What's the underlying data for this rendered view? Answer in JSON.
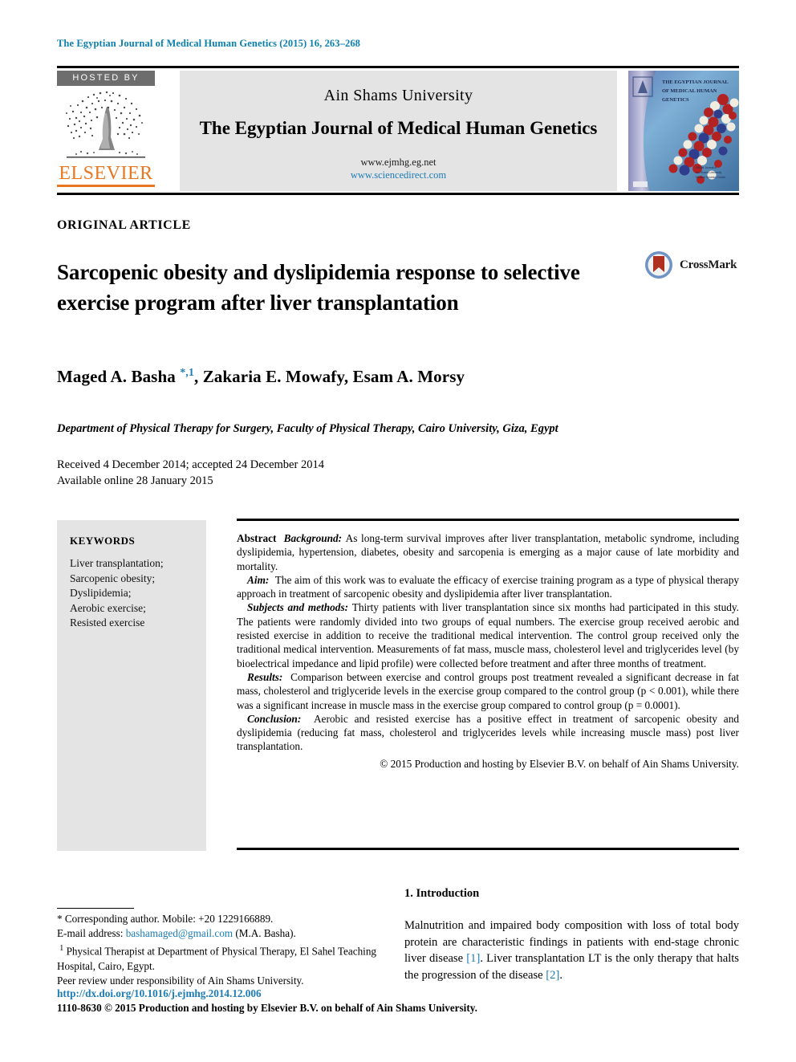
{
  "running_head": "The Egyptian Journal of Medical Human Genetics (2015) 16, 263–268",
  "masthead": {
    "hosted_by": "HOSTED BY",
    "publisher": "ELSEVIER",
    "university": "Ain Shams University",
    "journal_title": "The Egyptian Journal of Medical Human Genetics",
    "url_journal": "www.ejmhg.eg.net",
    "url_sciencedirect": "www.sciencedirect.com",
    "cover": {
      "line1": "THE EGYPTIAN JOURNAL",
      "line2": "OF MEDICAL HUMAN",
      "line3": "GENETICS"
    }
  },
  "article": {
    "type_label": "ORIGINAL ARTICLE",
    "title": "Sarcopenic obesity and dyslipidemia response to selective exercise program after liver transplantation",
    "crossmark_label": "CrossMark",
    "authors_html": "Maged A. Basha <span class=\"mark\">*,1</span>, Zakaria E. Mowafy, Esam A. Morsy",
    "affiliation": "Department of Physical Therapy for Surgery, Faculty of Physical Therapy, Cairo University, Giza, Egypt",
    "received": "Received 4 December 2014; accepted 24 December 2014",
    "available_online": "Available online 28 January 2015"
  },
  "keywords": {
    "heading": "KEYWORDS",
    "items": [
      "Liver transplantation;",
      "Sarcopenic obesity;",
      "Dyslipidemia;",
      "Aerobic exercise;",
      "Resisted exercise"
    ]
  },
  "abstract": {
    "label": "Abstract",
    "background_label": "Background:",
    "background_text": "As long-term survival improves after liver transplantation, metabolic syndrome, including dyslipidemia, hypertension, diabetes, obesity and sarcopenia is emerging as a major cause of late morbidity and mortality.",
    "aim_label": "Aim:",
    "aim_text": "The aim of this work was to evaluate the efficacy of exercise training program as a type of physical therapy approach in treatment of sarcopenic obesity and dyslipidemia after liver transplantation.",
    "methods_label": "Subjects and methods:",
    "methods_text": "Thirty patients with liver transplantation since six months had participated in this study. The patients were randomly divided into two groups of equal numbers. The exercise group received aerobic and resisted exercise in addition to receive the traditional medical intervention. The control group received only the traditional medical intervention. Measurements of fat mass, muscle mass, cholesterol level and triglycerides level (by bioelectrical impedance and lipid profile) were collected before treatment and after three months of treatment.",
    "results_label": "Results:",
    "results_text": "Comparison between exercise and control groups post treatment revealed a significant decrease in fat mass, cholesterol and triglyceride levels in the exercise group compared to the control group (p < 0.001), while there was a significant increase in muscle mass in the exercise group compared to control group (p = 0.0001).",
    "conclusion_label": "Conclusion:",
    "conclusion_text": "Aerobic and resisted exercise has a positive effect in treatment of sarcopenic obesity and dyslipidemia (reducing fat mass, cholesterol and triglycerides levels while increasing muscle mass) post liver transplantation.",
    "copyright": "© 2015 Production and hosting by Elsevier B.V. on behalf of Ain Shams University."
  },
  "footnotes": {
    "corresponding": "* Corresponding author. Mobile: +20 1229166889.",
    "email_label": "E-mail address:",
    "email": "bashamaged@gmail.com",
    "email_suffix": "(M.A. Basha).",
    "note1_marker": "1",
    "note1": "Physical Therapist at Department of Physical Therapy, El Sahel Teaching Hospital, Cairo, Egypt.",
    "peer_review": "Peer review under responsibility of Ain Shams University.",
    "doi": "http://dx.doi.org/10.1016/j.ejmhg.2014.12.006",
    "issn_copyright": "1110-8630 © 2015 Production and hosting by Elsevier B.V. on behalf of Ain Shams University."
  },
  "introduction": {
    "heading": "1. Introduction",
    "para1_a": "Malnutrition and impaired body composition with loss of total body protein are characteristic findings in patients with end-stage chronic liver disease ",
    "ref1": "[1]",
    "para1_b": ". Liver transplantation LT is the only therapy that halts the progression of the disease ",
    "ref2": "[2]",
    "para1_c": "."
  },
  "colors": {
    "running_head": "#0b7faf",
    "link_blue": "#1c7cb5",
    "elsevier_orange": "#e87722",
    "box_gray": "#e4e4e4",
    "hosted_gray": "#6d6d6d"
  }
}
